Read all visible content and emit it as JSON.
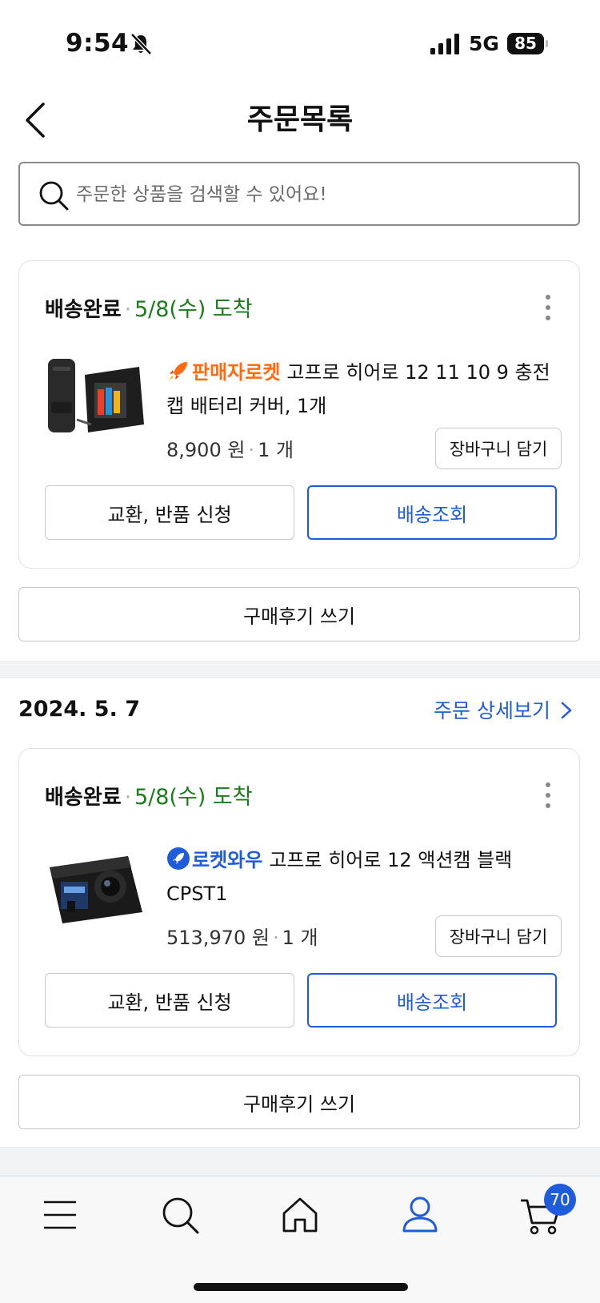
{
  "status_bar": {
    "time": "9:54",
    "network": "5G",
    "battery": "85"
  },
  "header": {
    "title": "주문목록"
  },
  "search": {
    "placeholder": "주문한 상품을 검색할 수 있어요!"
  },
  "orders": [
    {
      "status": "배송완료",
      "arrival": "5/8(수) 도착",
      "badge": "판매자로켓",
      "badge_color": "#ff6a13",
      "title": "고프로 히어로 12 11 10 9 충전캡 배터리 커버, 1개",
      "price": "8,900 원",
      "qty": "1 개",
      "cart_button": "장바구니 담기",
      "exchange_button": "교환, 반품 신청",
      "track_button": "배송조회",
      "review_button": "구매후기 쓰기"
    },
    {
      "date": "2024. 5. 7",
      "detail_link": "주문 상세보기",
      "status": "배송완료",
      "arrival": "5/8(수) 도착",
      "badge": "로켓와우",
      "badge_color": "#1f5cdc",
      "title": "고프로 히어로 12 액션캠 블랙 CPST1",
      "price": "513,970 원",
      "qty": "1 개",
      "cart_button": "장바구니 담기",
      "exchange_button": "교환, 반품 신청",
      "track_button": "배송조회",
      "review_button": "구매후기 쓰기"
    }
  ],
  "tab_bar": {
    "items": [
      "menu-icon",
      "search-icon",
      "home-icon",
      "user-icon",
      "cart-icon"
    ],
    "cart_count": "70",
    "active_color": "#1f5cdc"
  }
}
